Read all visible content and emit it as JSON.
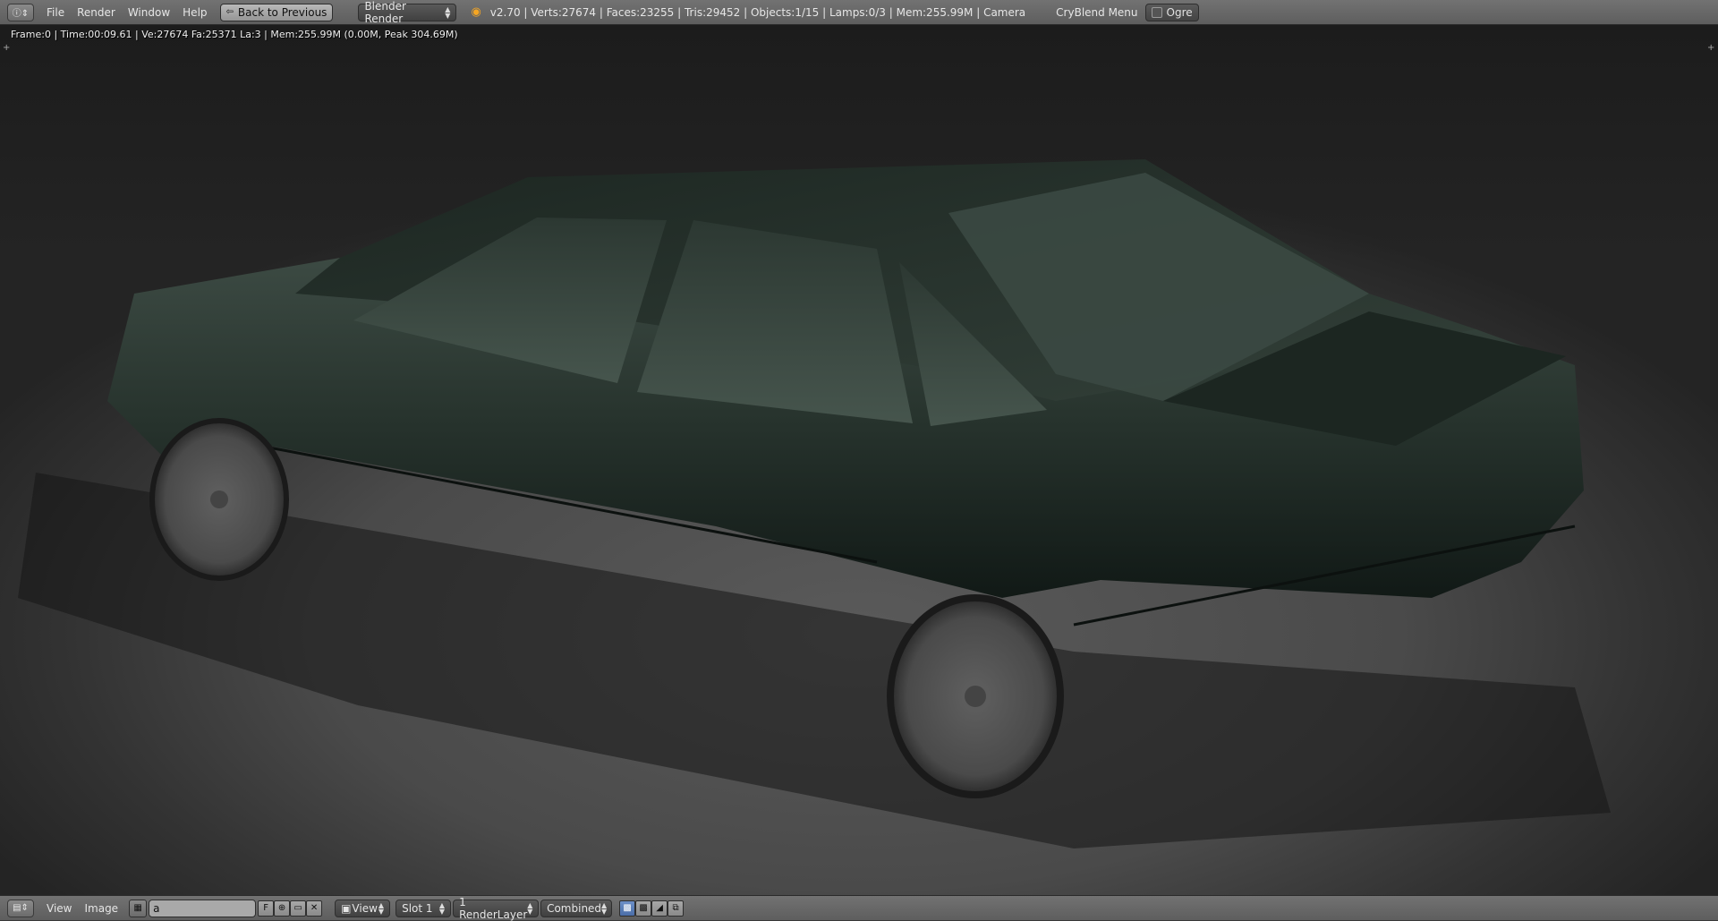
{
  "topbar": {
    "editor_icon": "info-icon",
    "menus": [
      "File",
      "Render",
      "Window",
      "Help"
    ],
    "back_label": "Back to Previous",
    "render_engine": "Blender Render",
    "stats": "v2.70 | Verts:27674 | Faces:23255 | Tris:29452 | Objects:1/15 | Lamps:0/3 | Mem:255.99M | Camera",
    "cryblend_label": "CryBlend Menu",
    "ogre_label": "Ogre"
  },
  "viewport": {
    "render_info": "Frame:0 | Time:00:09.61 | Ve:27674 Fa:25371 La:3 | Mem:255.99M (0.00M, Peak 304.69M)",
    "car_color": "#1f2a25"
  },
  "bottombar": {
    "menus": [
      "View",
      "Image"
    ],
    "image_name": "a",
    "fake_user_label": "F",
    "view_label": "View",
    "slot_label": "Slot 1",
    "render_layer": "1 RenderLayer",
    "pass_label": "Combined"
  }
}
